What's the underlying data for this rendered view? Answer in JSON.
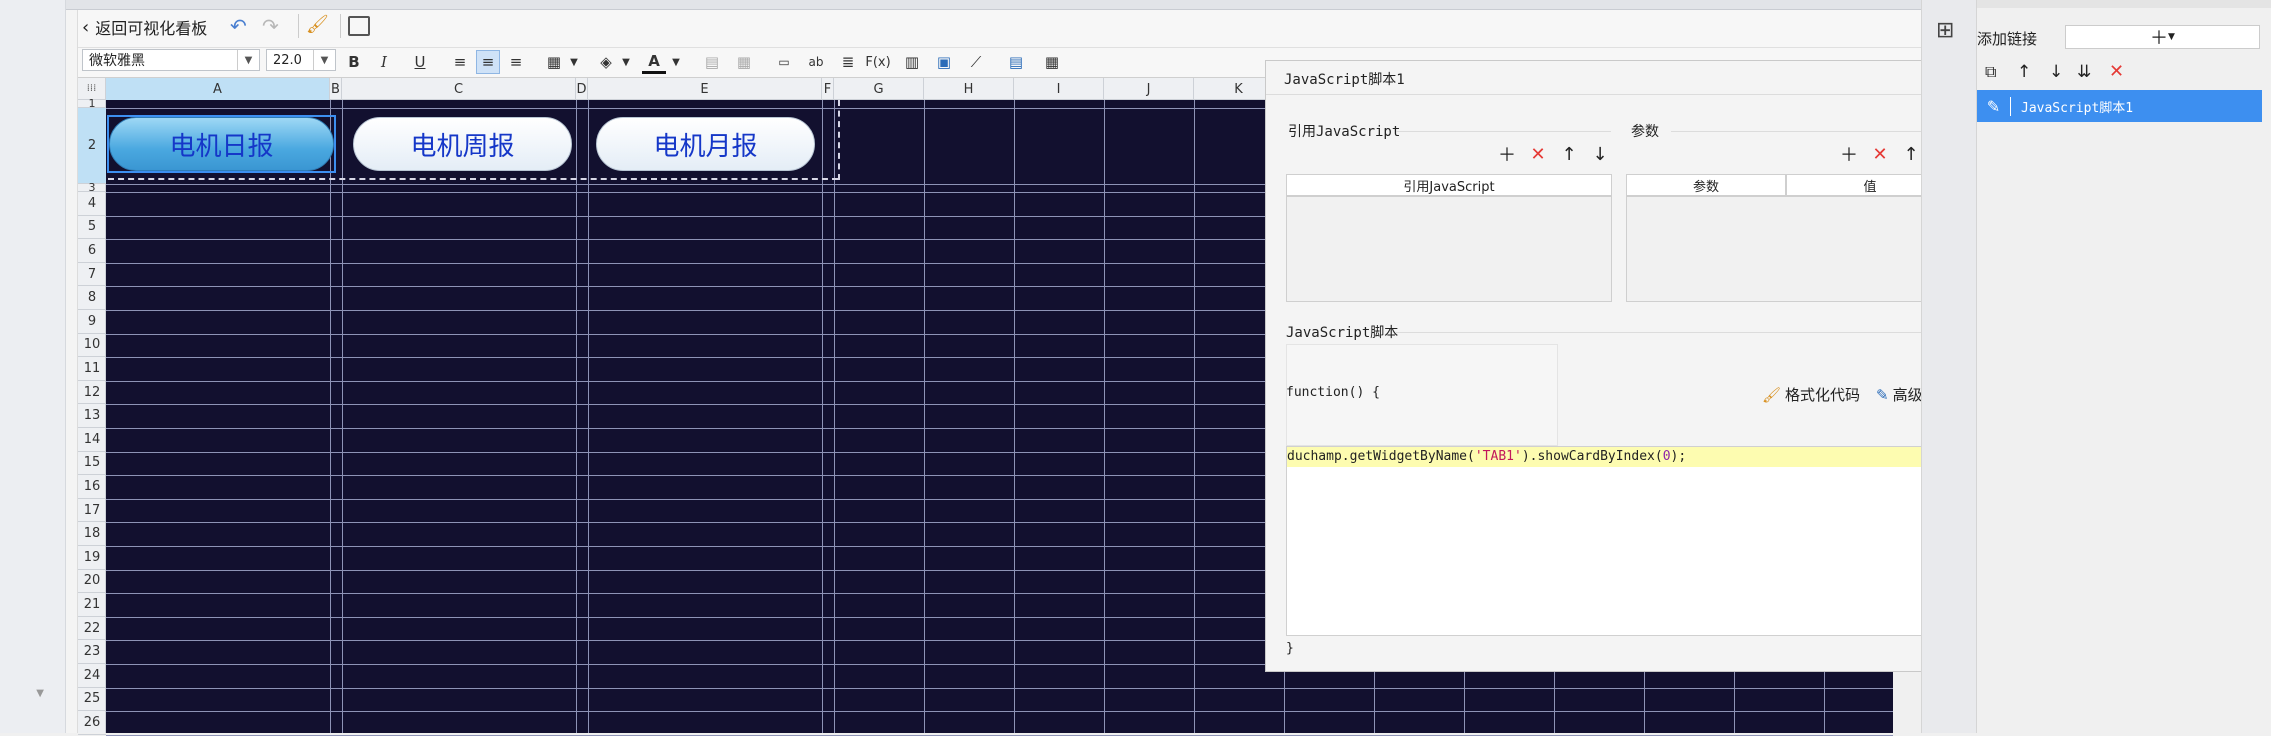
{
  "toolbar": {
    "back_label": "返回可视化看板",
    "font_name": "微软雅黑",
    "font_size": "22.0"
  },
  "sheet": {
    "columns": [
      "A",
      "B",
      "C",
      "D",
      "E",
      "F",
      "G",
      "H",
      "I",
      "J",
      "K"
    ],
    "rows": [
      "1",
      "2",
      "3",
      "4",
      "5",
      "6",
      "7",
      "8",
      "9",
      "10",
      "11",
      "12",
      "13",
      "14",
      "15",
      "16",
      "17",
      "18",
      "19",
      "20",
      "21",
      "22",
      "23",
      "24",
      "25",
      "26"
    ],
    "buttons": [
      "电机日报",
      "电机周报",
      "电机月报"
    ]
  },
  "dialog": {
    "title": "JavaScript脚本1",
    "ref_section": "引用JavaScript",
    "ref_col": "引用JavaScript",
    "param_section": "参数",
    "param_col": "参数",
    "value_col": "值",
    "script_section": "JavaScript脚本",
    "func_open": "function() {",
    "format_label": "格式化代码",
    "advanced_label": "高级编辑",
    "code_prefix": "duchamp.getWidgetByName(",
    "code_str": "'TAB1'",
    "code_mid": ").showCardByIndex(",
    "code_num": "0",
    "code_end": ");",
    "func_close": "}"
  },
  "right_panel": {
    "add_link_label": "添加链接",
    "item_label": "JavaScript脚本1"
  },
  "colors": {
    "grid_bg": "#12102f",
    "accent_blue": "#4aa8e0",
    "selection": "#3d8ff0",
    "delete_red": "#e53935"
  }
}
